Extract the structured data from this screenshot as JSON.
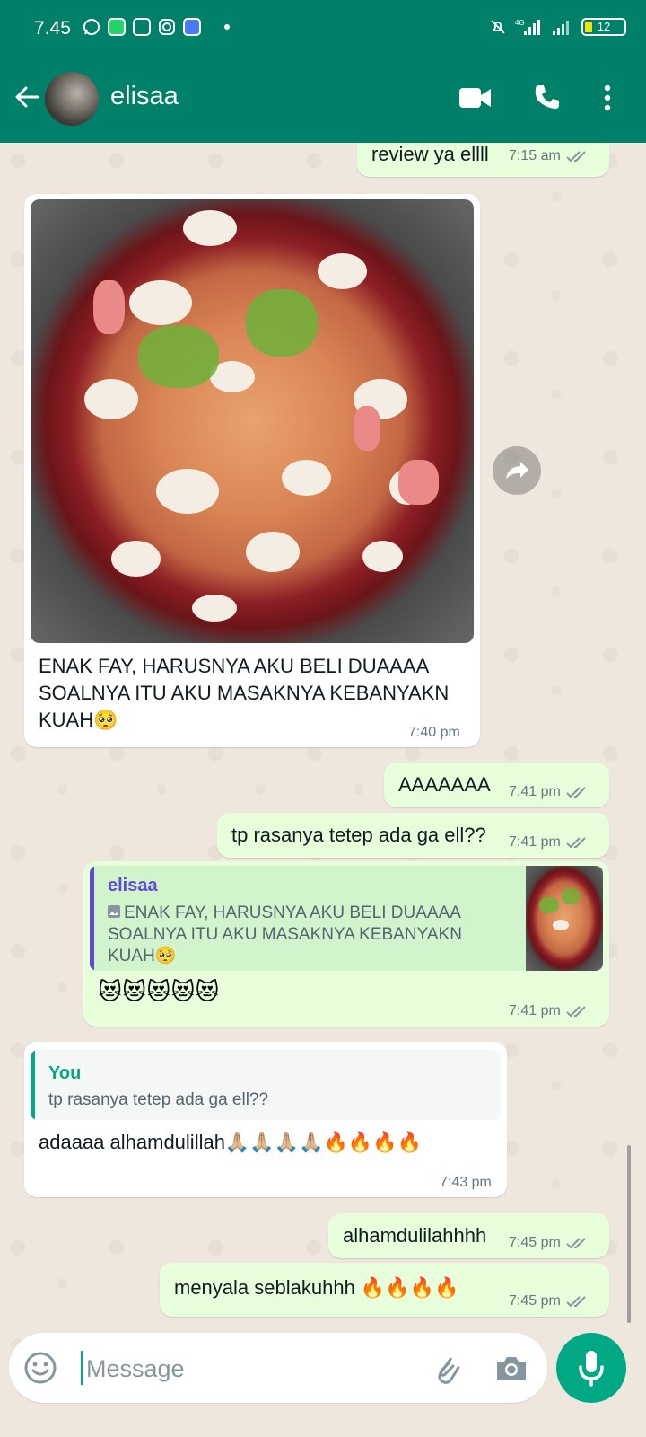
{
  "status_bar": {
    "time": "7.45",
    "battery": "12"
  },
  "header": {
    "contact_name": "elisaa"
  },
  "messages": [
    {
      "text": "review ya ellll",
      "time": "7:15 am"
    },
    {
      "caption_lines": [
        "ENAK FAY, HARUSNYA AKU BELI DUAAAA",
        "SOALNYA ITU AKU MASAKNYA KEBANYAKN",
        "KUAH🥺"
      ],
      "time": "7:40 pm"
    },
    {
      "text": "AAAAAAA",
      "time": "7:41 pm"
    },
    {
      "text": "tp rasanya tetep ada ga ell??",
      "time": "7:41 pm"
    },
    {
      "quote_name": "elisaa",
      "quote_lines": [
        "ENAK FAY, HARUSNYA AKU BELI DUAAAA",
        "SOALNYA ITU AKU MASAKNYA KEBANYAKN",
        "KUAH🥺"
      ],
      "text": "😻😻😻😻😻",
      "time": "7:41 pm"
    },
    {
      "quote_name": "You",
      "quote_text": "tp rasanya tetep ada ga ell??",
      "text": "adaaaa alhamdulillah🙏🏼🙏🏼🙏🏼🙏🏼🔥🔥🔥🔥",
      "time": "7:43 pm"
    },
    {
      "text": "alhamdulilahhhh",
      "time": "7:45 pm"
    },
    {
      "text": "menyala seblakuhhh 🔥🔥🔥🔥",
      "time": "7:45 pm"
    }
  ],
  "composer": {
    "placeholder": "Message"
  },
  "colors": {
    "header": "#008069",
    "outgoing": "#e7ffdb",
    "incoming": "#ffffff",
    "accent": "#00a884"
  }
}
